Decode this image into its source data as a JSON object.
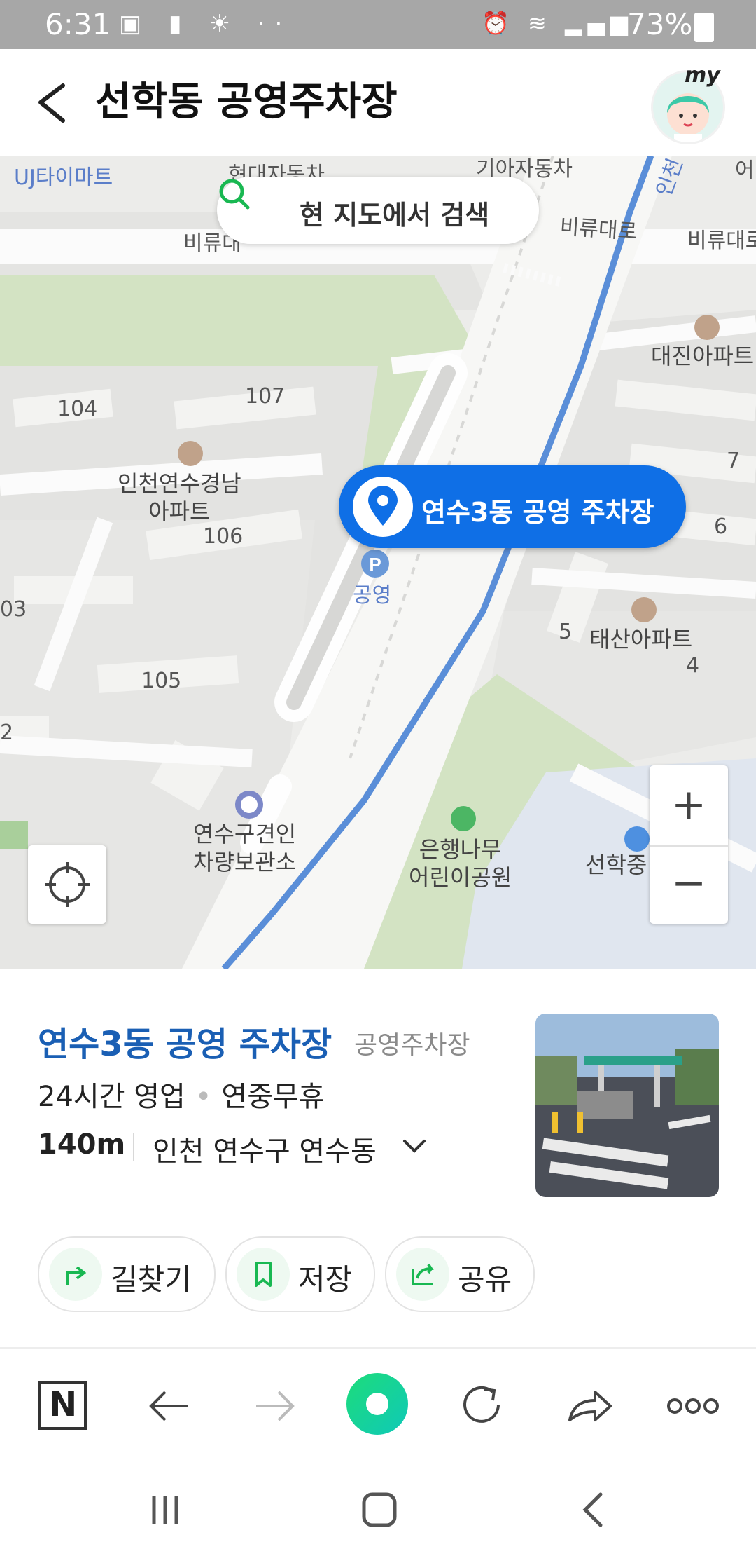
{
  "status_bar": {
    "time": "6:31",
    "battery": "73%"
  },
  "header": {
    "title": "선학동 공영주차장",
    "my_label": "my"
  },
  "map": {
    "search_label": "현 지도에서 검색",
    "callout": "연수3동 공영 주차장",
    "labels": {
      "uj_mart": "UJ타이마트",
      "hyundai": "현대자동차",
      "kia": "기아자동차",
      "biryu1": "비류대",
      "biryu2": "비류대로",
      "biryu3": "비류대로",
      "incheon_road": "인천",
      "daejin": "대진아파트",
      "b104": "104",
      "b107": "107",
      "gyeongnam": "인천연수경남\n아파트",
      "b106": "106",
      "b103": "03",
      "b105": "105",
      "b2": "2",
      "b7": "7",
      "b6": "6",
      "b5": "5",
      "b4": "4",
      "taesan": "태산아파트",
      "parking": "공영",
      "storage": "연수구견인\n차량보관소",
      "park": "은행나무\n어린이공원",
      "school": "선학중",
      "top_right": "어"
    },
    "zoom_in": "+",
    "zoom_out": "−",
    "colors": {
      "route": "#5a8ed8",
      "callout": "#0f6fe6",
      "green_area": "#d3e3c3"
    }
  },
  "info": {
    "name": "연수3동 공영 주차장",
    "category": "공영주차장",
    "hours": "24시간 영업",
    "holiday": "연중무휴",
    "distance": "140m",
    "address": "인천 연수구 연수동",
    "actions": {
      "directions": "길찾기",
      "save": "저장",
      "share": "공유"
    }
  },
  "browser_bar": {
    "naver_logo": "N",
    "icons": [
      "back-arrow-icon",
      "forward-arrow-icon",
      "home-icon",
      "refresh-icon",
      "share-icon",
      "more-icon"
    ]
  }
}
